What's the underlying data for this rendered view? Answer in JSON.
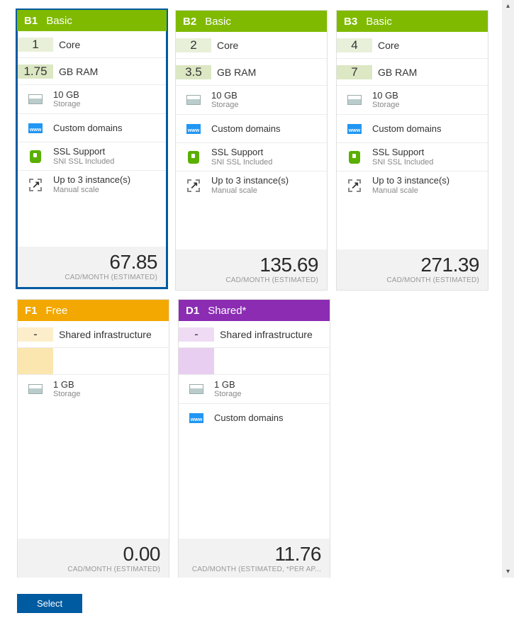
{
  "price_label": "CAD/MONTH (ESTIMATED)",
  "price_label_shared": "CAD/MONTH (ESTIMATED, *PER AP...",
  "labels": {
    "core": "Core",
    "ram": "GB RAM",
    "shared_infra": "Shared infrastructure",
    "dash": "-",
    "storage": "Storage",
    "custom_domains": "Custom domains",
    "ssl_support": "SSL Support",
    "ssl_sub": "SNI SSL Included",
    "instances": "Up to 3 instance(s)",
    "instances_sub": "Manual scale"
  },
  "tiers": {
    "b1": {
      "code": "B1",
      "name": "Basic",
      "cores": "1",
      "ram": "1.75",
      "storage": "10 GB",
      "price": "67.85"
    },
    "b2": {
      "code": "B2",
      "name": "Basic",
      "cores": "2",
      "ram": "3.5",
      "storage": "10 GB",
      "price": "135.69"
    },
    "b3": {
      "code": "B3",
      "name": "Basic",
      "cores": "4",
      "ram": "7",
      "storage": "10 GB",
      "price": "271.39"
    },
    "f1": {
      "code": "F1",
      "name": "Free",
      "storage": "1 GB",
      "price": "0.00"
    },
    "d1": {
      "code": "D1",
      "name": "Shared*",
      "storage": "1 GB",
      "price": "11.76"
    }
  },
  "select_button": "Select"
}
